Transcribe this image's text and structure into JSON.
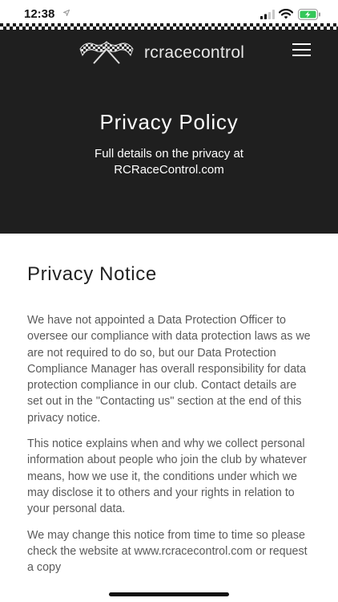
{
  "status_bar": {
    "time": "12:38",
    "icons": [
      "location-arrow-icon",
      "signal-icon",
      "wifi-icon",
      "battery-charging-icon"
    ],
    "battery_color": "#34c759"
  },
  "header": {
    "logo_text": "rcracecontrol",
    "logo_icon": "checkered-flags-icon",
    "menu_icon": "hamburger-menu-icon",
    "background": "#1f1f1f"
  },
  "hero": {
    "title": "Privacy Policy",
    "subtitle": "Full details on the privacy at RCRaceControl.com"
  },
  "content": {
    "heading": "Privacy Notice",
    "paragraphs": [
      "We have not appointed a Data Protection Officer to oversee our compliance with data protection laws as we are not required to do so, but our Data Protection Compliance Manager has overall responsibility for data protection compliance in our club. Contact details are set out in the \"Contacting us\" section at the end of this privacy notice.",
      "This notice explains when and why we collect personal information about people who join the club by whatever means, how we use it, the conditions under which we may disclose it to others and your rights in relation to your personal data.",
      "We may change this notice from time to time so please check the website at www.rcracecontrol.com or request a copy"
    ]
  }
}
